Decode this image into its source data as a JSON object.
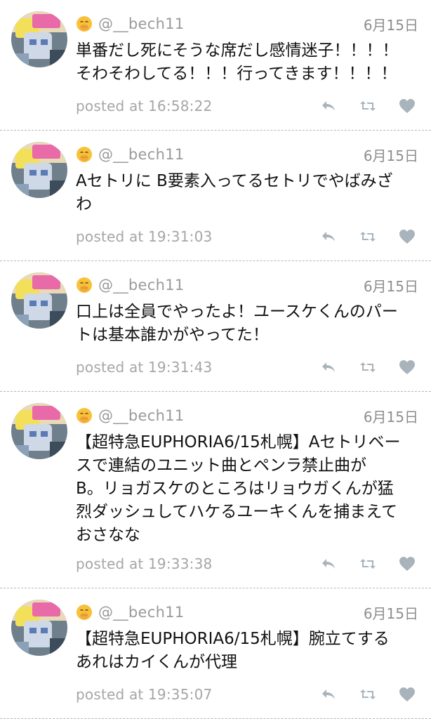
{
  "tweets": [
    {
      "username": "@__bech11",
      "date": "6月15日",
      "text": "単番だし死にそうな席だし感情迷子！！！！\nそわそわしてる！！！行ってきます！！！！",
      "posted": "posted at 16:58:22"
    },
    {
      "username": "@__bech11",
      "date": "6月15日",
      "text": "Aセトリに B要素入ってるセトリでやばみざ\nわ",
      "posted": "posted at 19:31:03"
    },
    {
      "username": "@__bech11",
      "date": "6月15日",
      "text": "口上は全員でやったよ！ユースケくんのパー\nトは基本誰かがやってた！",
      "posted": "posted at 19:31:43"
    },
    {
      "username": "@__bech11",
      "date": "6月15日",
      "text": "【超特急EUPHORIA6/15札幌】Aセトリベー\nスで連結のユニット曲とペンラ禁止曲が\nB。リョガスケのところはリョウガくんが猛\n烈ダッシュしてハケるユーキくんを捕まえて\nおさなな",
      "posted": "posted at 19:33:38"
    },
    {
      "username": "@__bech11",
      "date": "6月15日",
      "text": "【超特急EUPHORIA6/15札幌】腕立てする\nあれはカイくんが代理",
      "posted": "posted at 19:35:07"
    }
  ],
  "icons": {
    "user_emoji": "face-with-hand-over-mouth-icon",
    "reply": "reply-icon",
    "retweet": "retweet-icon",
    "like": "heart-icon"
  },
  "colors": {
    "icon_gray": "#a9b3bb",
    "meta_gray": "#9a9a9a",
    "divider": "#b8b8b8"
  }
}
